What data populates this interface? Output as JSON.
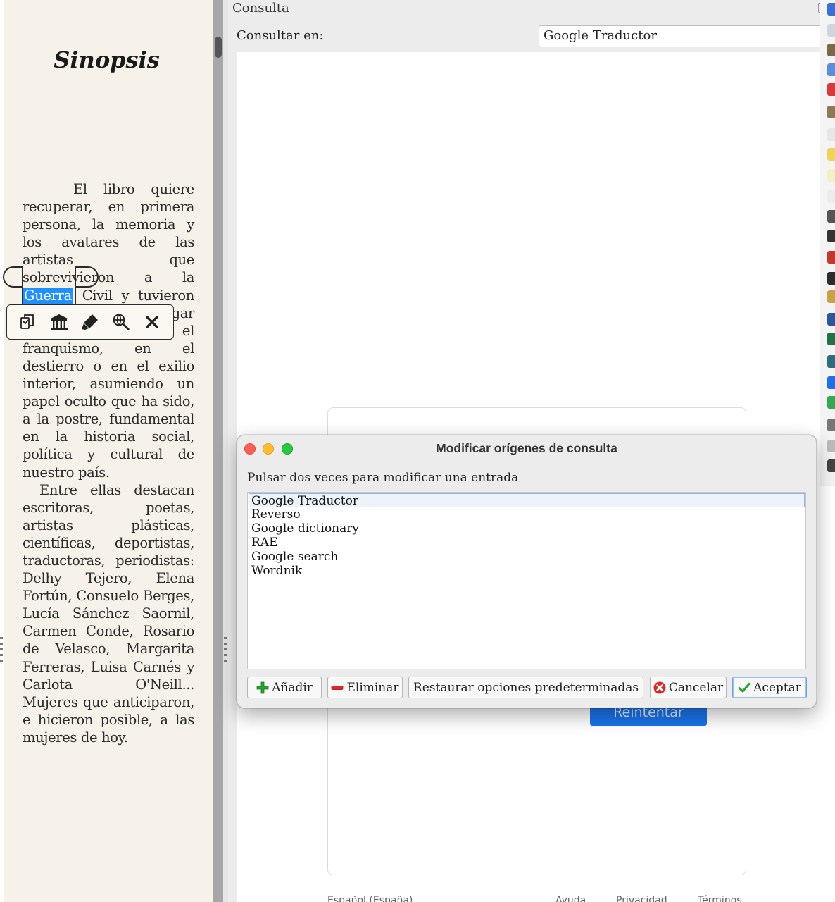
{
  "reader": {
    "title": "Sinopsis",
    "para1_before": "El libro quiere recuperar, en primera persona, la memoria y los avatares de las artistas que sobrevivieron a la ",
    "selected_word": "Guerra",
    "para1_after": " Civil y tuvieron que enfrentarse al lugar que les deparaba el franquismo, en el destierro o en el exilio interior, asumiendo un papel oculto que ha sido, a la postre, fundamental en la historia social, política y cultural de nuestro país.",
    "para2": "Entre ellas destacan escritoras, poetas, artistas plásticas, científicas, deportistas, traductoras, periodistas: Delhy Tejero, Elena Fortún, Consuelo Berges, Lucía Sánchez Saornil, Carmen Conde, Rosario de Velasco, Margarita Ferreras, Luisa Carnés y Carlota O'Neill... Mujeres que anticiparon, e hicieron posible, a las mujeres de hoy.",
    "selection_toolbar": [
      "copy-icon",
      "museum-icon",
      "highlighter-icon",
      "web-search-icon",
      "close-icon"
    ]
  },
  "consulta": {
    "title": "Consulta",
    "lookup_label": "Consultar en:",
    "selected_source": "Google Traductor",
    "webview": {
      "retry_label": "Reintentar",
      "footer": [
        "Español (España)",
        "Ayuda",
        "Privacidad",
        "Términos"
      ]
    }
  },
  "dialog": {
    "title": "Modificar orígenes de consulta",
    "hint": "Pulsar dos veces para modificar una entrada",
    "items": [
      "Google Traductor",
      "Reverso",
      "Google dictionary",
      "RAE",
      "Google search",
      "Wordnik"
    ],
    "selected_index": 0,
    "buttons": {
      "add": "Añadir",
      "remove": "Eliminar",
      "restore": "Restaurar opciones predeterminadas",
      "cancel": "Cancelar",
      "accept": "Aceptar"
    },
    "colors": {
      "close": "#fe5f57",
      "minimize": "#febc2e",
      "maximize": "#28c840",
      "selection": "#1e90ff"
    }
  }
}
